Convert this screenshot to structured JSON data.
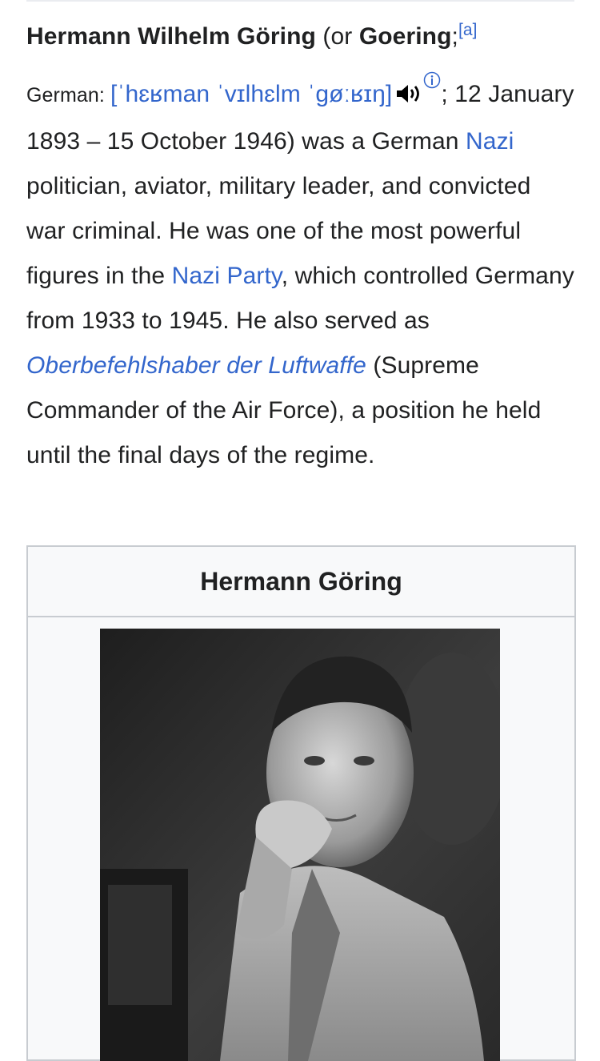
{
  "article": {
    "name_bold": "Hermann Wilhelm Göring",
    "or_open": " (or ",
    "alt_name": "Goering",
    "semicolon": ";",
    "footnote": "[a]",
    "language": "German: ",
    "ipa": "[ˈhɛʁman ˈvɪlhɛlm ˈɡøːʁɪŋ]",
    "dates": "; 12 January 1893 – 15 October 1946) was a German ",
    "link_nazi": "Nazi",
    "text_1": " politician, aviator, military leader, and convicted war criminal. He was one of the most powerful figures in the ",
    "link_nazi_party": "Nazi Party",
    "text_2": ", which controlled Germany from 1933 to 1945. He also served as ",
    "link_oberbefehlshaber": "Oberbefehlshaber der Luftwaffe",
    "text_3": " (Supreme Commander of the Air Force), a position he held until the final days of the regime."
  },
  "infobox": {
    "title": "Hermann Göring"
  },
  "icons": {
    "speaker": "speaker-icon",
    "info": "info-icon"
  },
  "colors": {
    "link": "#3366cc",
    "text": "#202122",
    "infobox_border": "#c8ccd1",
    "infobox_bg": "#f8f9fa"
  }
}
